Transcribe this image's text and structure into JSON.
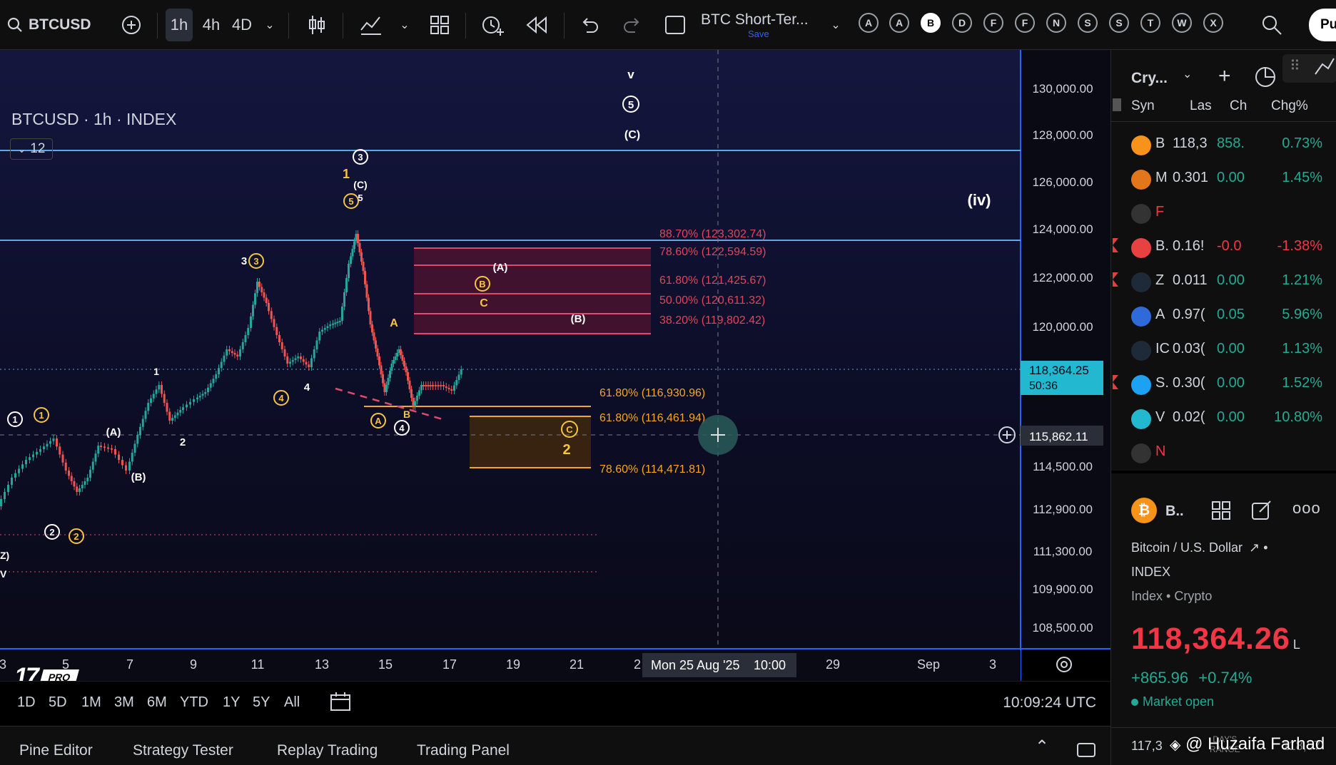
{
  "toolbar": {
    "symbol": "BTCUSD",
    "timeframes": [
      "1h",
      "4h",
      "4D"
    ],
    "layout_name": "BTC Short-Ter...",
    "save_label": "Save",
    "watchlist_letters": [
      "A",
      "A",
      "B",
      "D",
      "F",
      "F",
      "N",
      "S",
      "S",
      "T",
      "W",
      "X"
    ],
    "publish_label": "Pu"
  },
  "legend": {
    "title": "BTCUSD · 1h · INDEX",
    "indicator_count": "12"
  },
  "price_axis": {
    "labels": [
      "130,000.00",
      "128,000.00",
      "126,000.00",
      "124,000.00",
      "122,000.00",
      "120,000.00",
      "114,500.00",
      "112,900.00",
      "111,300.00",
      "109,900.00",
      "108,500.00"
    ],
    "last_price": "118,364.25",
    "countdown": "50:36",
    "crosshair_price": "115,862.11"
  },
  "time_axis": {
    "labels": [
      "3",
      "5",
      "7",
      "9",
      "11",
      "13",
      "15",
      "17",
      "19",
      "21",
      "2",
      "29",
      "Sep",
      "3"
    ],
    "crosshair_label": "Mon 25 Aug '25",
    "crosshair_time": "10:00"
  },
  "fib_red": [
    {
      "label": "88.70% (123,302.74)"
    },
    {
      "label": "78.60% (122,594.59)"
    },
    {
      "label": "61.80% (121,425.67)"
    },
    {
      "label": "50.00% (120,611.32)"
    },
    {
      "label": "38.20% (119,802.42)"
    }
  ],
  "fib_orange": [
    {
      "label": "61.80% (116,930.96)"
    },
    {
      "label": "61.80% (116,461.94)"
    },
    {
      "label": "78.60% (114,471.81)"
    }
  ],
  "wave_labels": {
    "v": "v",
    "iv": "(iv)",
    "c_top": "(C)",
    "five_top": "5",
    "three": "3",
    "one": "1",
    "c_mid": "(C)",
    "five_small": "5",
    "three_left": "3",
    "a_paren": "(A)",
    "b_circle": "B",
    "c_plain": "C",
    "b_paren": "(B)",
    "a_plain": "A",
    "one_small": "1",
    "four_plain": "4",
    "four_circle": "4",
    "a_circle": "A",
    "b_small": "B",
    "four_white": "4",
    "c_circle": "C",
    "two_big": "2",
    "one_white": "1",
    "one_orange": "1",
    "a_left": "(A)",
    "two_small": "2",
    "b_left": "(B)",
    "two_white": "2",
    "two_orange": "2",
    "z_left": "Z)",
    "v_left": "V"
  },
  "logo": {
    "pro": "PRO"
  },
  "ranges": [
    "1D",
    "5D",
    "1M",
    "3M",
    "6M",
    "YTD",
    "1Y",
    "5Y",
    "All"
  ],
  "clock": "10:09:24 UTC",
  "panel_tabs": [
    "Pine Editor",
    "Strategy Tester",
    "Replay Trading",
    "Trading Panel"
  ],
  "watchlist": {
    "title": "Cry...",
    "columns": [
      "Syn",
      "Las",
      "Ch",
      "Chg%"
    ],
    "rows": [
      {
        "sym": "B",
        "last": "118,3",
        "ch": "858.",
        "chg": "0.73%",
        "dir": "pos",
        "color": "#f7931a",
        "flag": false
      },
      {
        "sym": "M",
        "last": "0.301",
        "ch": "0.00",
        "chg": "1.45%",
        "dir": "pos",
        "color": "#e2761b",
        "flag": false
      },
      {
        "sym": "F",
        "last": "",
        "ch": "",
        "chg": "",
        "dir": "neg",
        "color": "#333333",
        "flag": false
      },
      {
        "sym": "B.",
        "last": "0.16!",
        "ch": "-0.0",
        "chg": "-1.38%",
        "dir": "neg",
        "color": "#e84142",
        "flag": true
      },
      {
        "sym": "Z",
        "last": "0.011",
        "ch": "0.00",
        "chg": "1.21%",
        "dir": "pos",
        "color": "#1e2a38",
        "flag": true
      },
      {
        "sym": "A",
        "last": "0.97(",
        "ch": "0.05",
        "chg": "5.96%",
        "dir": "pos",
        "color": "#2f6bd8",
        "flag": false
      },
      {
        "sym": "IC",
        "last": "0.03(",
        "ch": "0.00",
        "chg": "1.13%",
        "dir": "pos",
        "color": "#1e2a38",
        "flag": false
      },
      {
        "sym": "S.",
        "last": "0.30(",
        "ch": "0.00",
        "chg": "1.52%",
        "dir": "pos",
        "color": "#1da1f2",
        "flag": true
      },
      {
        "sym": "V",
        "last": "0.02(",
        "ch": "0.00",
        "chg": "10.80%",
        "dir": "pos",
        "color": "#22b8cf",
        "flag": false
      },
      {
        "sym": "N",
        "last": "",
        "ch": "",
        "chg": "",
        "dir": "neg",
        "color": "#333333",
        "flag": false
      }
    ]
  },
  "details": {
    "short": "B..",
    "pair": "Bitcoin / U.S. Dollar",
    "exchange": "INDEX",
    "type": "Index • Crypto",
    "price": "118,364.26",
    "price_suffix": "L",
    "change": "+865.96",
    "change_pct": "+0.74%",
    "status": "Market open",
    "range_low": "117,3",
    "range_label_1": "DAY'S",
    "range_label_2": "RANGE",
    "watermark": "@ Huzaifa Farhad",
    "range_high": "118,57"
  }
}
